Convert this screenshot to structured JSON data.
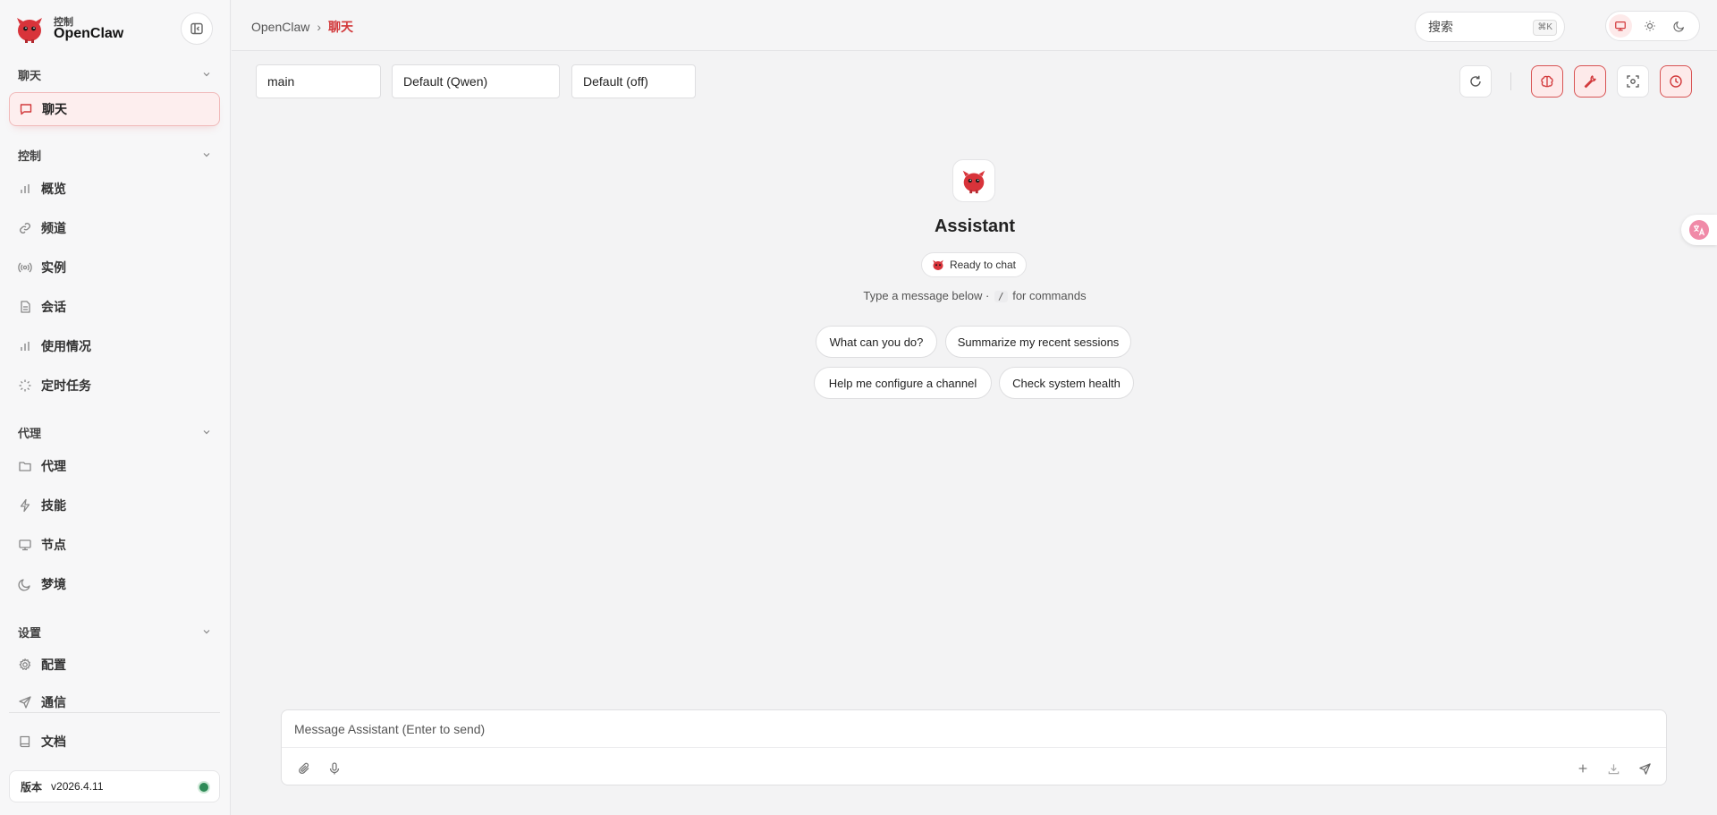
{
  "brand": {
    "sub": "控制",
    "name": "OpenClaw"
  },
  "sidebar": {
    "sections": [
      {
        "title": "聊天",
        "items": [
          {
            "label": "聊天",
            "icon": "chat-icon"
          }
        ]
      },
      {
        "title": "控制",
        "items": [
          {
            "label": "概览",
            "icon": "bar-chart-icon"
          },
          {
            "label": "频道",
            "icon": "link-icon"
          },
          {
            "label": "实例",
            "icon": "radio-icon"
          },
          {
            "label": "会话",
            "icon": "document-icon"
          },
          {
            "label": "使用情况",
            "icon": "bar-chart-icon"
          },
          {
            "label": "定时任务",
            "icon": "loader-icon"
          }
        ]
      },
      {
        "title": "代理",
        "items": [
          {
            "label": "代理",
            "icon": "folder-icon"
          },
          {
            "label": "技能",
            "icon": "zap-icon"
          },
          {
            "label": "节点",
            "icon": "monitor-icon"
          },
          {
            "label": "梦境",
            "icon": "moon-icon"
          }
        ]
      },
      {
        "title": "设置",
        "items": [
          {
            "label": "配置",
            "icon": "gear-icon"
          },
          {
            "label": "通信",
            "icon": "send-icon"
          }
        ]
      }
    ],
    "docs_label": "文档",
    "version_label": "版本",
    "version_value": "v2026.4.11"
  },
  "header": {
    "breadcrumb_root": "OpenClaw",
    "breadcrumb_sep": "›",
    "breadcrumb_current": "聊天",
    "search_label": "搜索",
    "search_shortcut": "⌘K"
  },
  "toolbar": {
    "session_value": "main",
    "model_value": "Default (Qwen)",
    "thinking_value": "Default (off)"
  },
  "chat": {
    "assistant_name": "Assistant",
    "status": "Ready to chat",
    "hint_pre": "Type a message below ·",
    "hint_slash": "/",
    "hint_post": "for commands",
    "suggestions": [
      "What can you do?",
      "Summarize my recent sessions",
      "Help me configure a channel",
      "Check system health"
    ],
    "composer_placeholder": "Message Assistant (Enter to send)"
  },
  "colors": {
    "accent": "#d2383a",
    "accent_bg": "#fdeaea",
    "online": "#2e8b57"
  }
}
